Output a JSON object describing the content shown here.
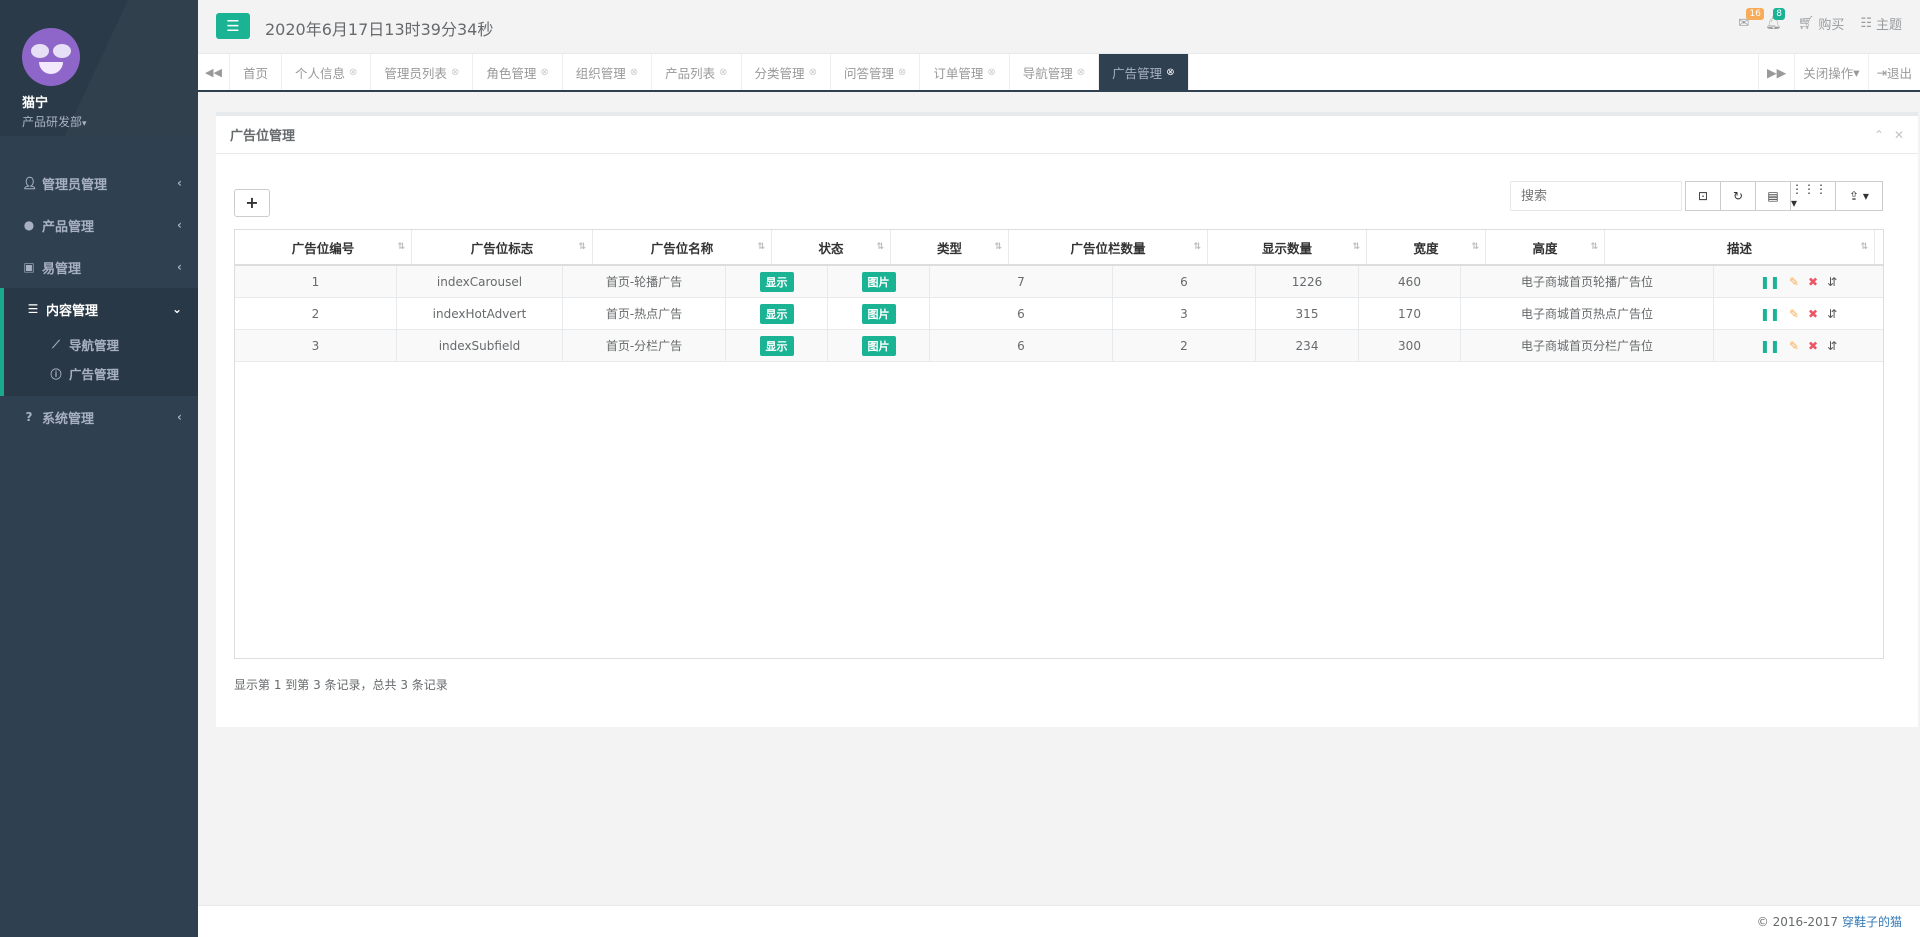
{
  "profile": {
    "name": "猫宁",
    "department": "产品研发部"
  },
  "sidebar": {
    "items": [
      {
        "label": "管理员管理",
        "icon": "user-icon"
      },
      {
        "label": "产品管理",
        "icon": "product-icon"
      },
      {
        "label": "易管理",
        "icon": "money-icon"
      },
      {
        "label": "内容管理",
        "icon": "list-icon",
        "active": true,
        "children": [
          {
            "label": "导航管理",
            "icon": "line-chart-icon"
          },
          {
            "label": "广告管理",
            "icon": "info-icon"
          }
        ]
      },
      {
        "label": "系统管理",
        "icon": "question-icon"
      }
    ]
  },
  "topbar": {
    "datetime": "2020年6月17日13时39分34秒",
    "mail_badge": "16",
    "bell_badge": "8",
    "buy_label": "购买",
    "theme_label": "主题"
  },
  "tabs": {
    "items": [
      "首页",
      "个人信息",
      "管理员列表",
      "角色管理",
      "组织管理",
      "产品列表",
      "分类管理",
      "问答管理",
      "订单管理",
      "导航管理",
      "广告管理"
    ],
    "active": "广告管理",
    "close_ops": "关闭操作",
    "logout": "退出"
  },
  "panel": {
    "title": "广告位管理",
    "search_placeholder": "搜索",
    "columns": [
      "广告位编号",
      "广告位标志",
      "广告位名称",
      "状态",
      "类型",
      "广告位栏数量",
      "显示数量",
      "宽度",
      "高度",
      "描述"
    ],
    "rows": [
      {
        "id": "1",
        "flag": "indexCarousel",
        "name": "首页-轮播广告",
        "status": "显示",
        "type": "图片",
        "columns": "7",
        "display": "6",
        "width": "1226",
        "height": "460",
        "desc": "电子商城首页轮播广告位"
      },
      {
        "id": "2",
        "flag": "indexHotAdvert",
        "name": "首页-热点广告",
        "status": "显示",
        "type": "图片",
        "columns": "6",
        "display": "3",
        "width": "315",
        "height": "170",
        "desc": "电子商城首页热点广告位"
      },
      {
        "id": "3",
        "flag": "indexSubfield",
        "name": "首页-分栏广告",
        "status": "显示",
        "type": "图片",
        "columns": "6",
        "display": "2",
        "width": "234",
        "height": "300",
        "desc": "电子商城首页分栏广告位"
      }
    ],
    "pagination_info": "显示第 1 到第 3 条记录，总共 3 条记录"
  },
  "footer": {
    "copyright": "© 2016-2017",
    "author": "穿鞋子的猫"
  },
  "colors": {
    "primary": "#1ab394",
    "sidebar": "#2f4050",
    "warning": "#f8ac59",
    "danger": "#ed5565"
  }
}
